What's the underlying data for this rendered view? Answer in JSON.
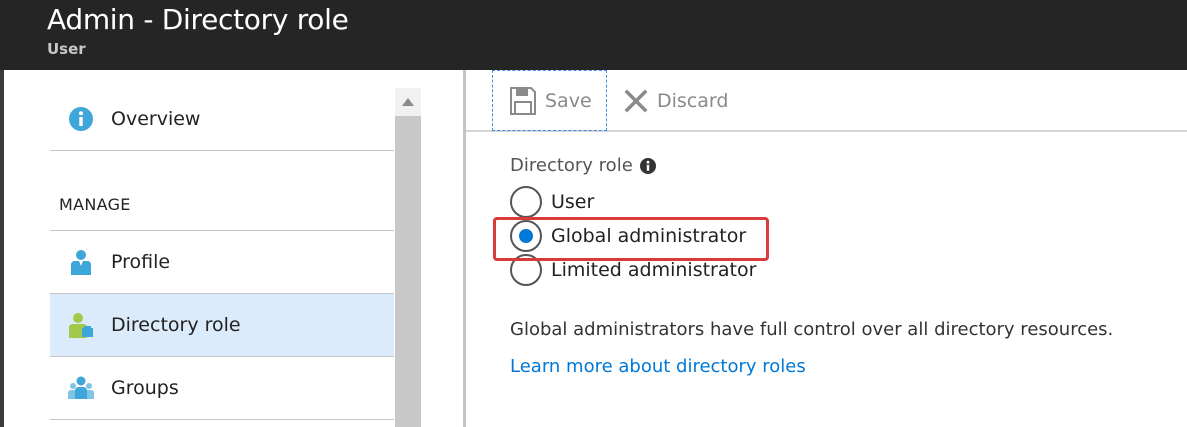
{
  "window": {
    "title": "Admin - Directory role",
    "subtitle": "User"
  },
  "sidebar": {
    "items": [
      {
        "label": "Overview",
        "icon": "info-circle-icon"
      },
      {
        "label": "Profile",
        "icon": "user-profile-icon"
      },
      {
        "label": "Directory role",
        "icon": "user-role-icon",
        "selected": true
      },
      {
        "label": "Groups",
        "icon": "groups-icon"
      }
    ],
    "section_heading": "MANAGE"
  },
  "toolbar": {
    "save_label": "Save",
    "discard_label": "Discard"
  },
  "directory_role": {
    "label": "Directory role",
    "options": [
      {
        "label": "User",
        "checked": false
      },
      {
        "label": "Global administrator",
        "checked": true
      },
      {
        "label": "Limited administrator",
        "checked": false
      }
    ],
    "description": "Global administrators have full control over all directory resources.",
    "learn_more": "Learn more about directory roles"
  },
  "colors": {
    "titlebar_bg": "#252526",
    "accent": "#0078d7",
    "selected_bg": "#dcebfc",
    "highlight_border": "#d83b3b",
    "disabled_text": "#8a8a8a"
  }
}
